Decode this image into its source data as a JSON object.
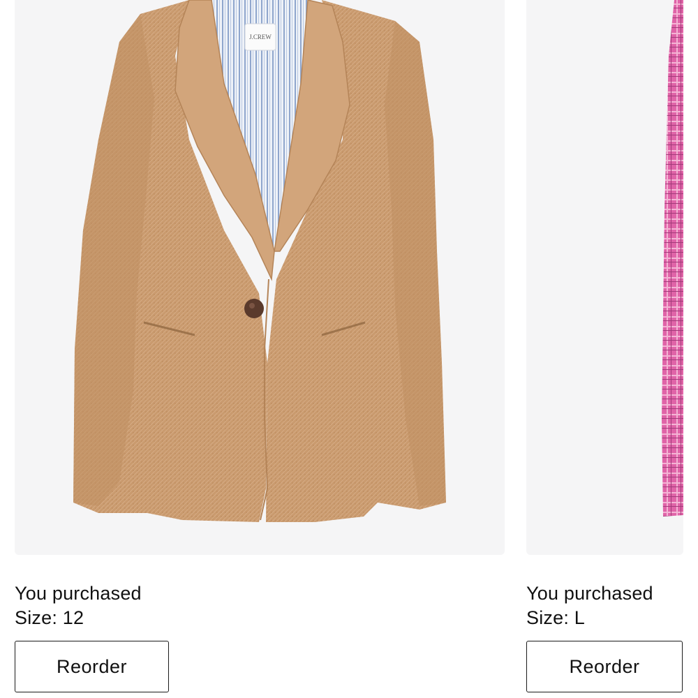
{
  "products": [
    {
      "purchased_label": "You purchased",
      "size_text": "Size: 12",
      "reorder_label": "Reorder",
      "image_icon": "blazer-image",
      "colors": {
        "fabric": "#c99a6e",
        "lining": "#dfe7f2",
        "button": "#5a3a2c"
      }
    },
    {
      "purchased_label": "You purchased",
      "size_text": "Size: L",
      "reorder_label": "Reorder",
      "image_icon": "plaid-shirt-image",
      "colors": {
        "fabric": "#e064a8"
      }
    }
  ],
  "blazer_label_text": "J.CREW"
}
